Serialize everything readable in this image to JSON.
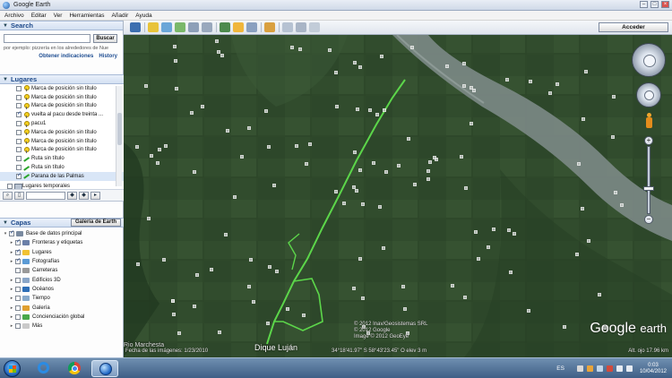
{
  "window": {
    "title": "Google Earth"
  },
  "menu": [
    "Archivo",
    "Editar",
    "Ver",
    "Herramientas",
    "Añadir",
    "Ayuda"
  ],
  "search": {
    "header": "Search",
    "button_label": "Buscar",
    "hint": "por ejemplo: pizzería en los alrededores de Nue",
    "link_directions": "Obtener indicaciones",
    "link_history": "History"
  },
  "places": {
    "header": "Lugares",
    "items": [
      {
        "label": "Marca de posición sin título",
        "icon": "pushpin-icon",
        "checked": false
      },
      {
        "label": "Marca de posición sin título",
        "icon": "pushpin-icon",
        "checked": false
      },
      {
        "label": "Marca de posición sin título",
        "icon": "pushpin-icon",
        "checked": false
      },
      {
        "label": "vuelta al pacu desde treinta ...",
        "icon": "pushpin-icon",
        "checked": true
      },
      {
        "label": "pacu1",
        "icon": "pushpin-icon",
        "checked": false
      },
      {
        "label": "Marca de posición sin título",
        "icon": "pushpin-icon",
        "checked": false
      },
      {
        "label": "Marca de posición sin título",
        "icon": "pushpin-icon",
        "checked": false
      },
      {
        "label": "Marca de posición sin título",
        "icon": "pushpin-icon",
        "checked": false
      },
      {
        "label": "Ruta sin título",
        "icon": "route-icon",
        "checked": false
      },
      {
        "label": "Ruta sin título",
        "icon": "route-icon",
        "checked": false
      },
      {
        "label": "Parana de las Palmas",
        "icon": "route-icon",
        "checked": true
      },
      {
        "label": "Lugares temporales",
        "icon": "folder-icon",
        "checked": false
      }
    ]
  },
  "layers": {
    "header": "Capas",
    "gallery_button": "Galería de Earth",
    "items": [
      {
        "label": "Base de datos principal",
        "color": "#7a8aa0"
      },
      {
        "label": "Fronteras y etiquetas",
        "color": "#6a7fa8"
      },
      {
        "label": "Lugares",
        "color": "#f1c232"
      },
      {
        "label": "Fotografías",
        "color": "#5b9bd5"
      },
      {
        "label": "Carreteras",
        "color": "#9a9a9a"
      },
      {
        "label": "Edificios 3D",
        "color": "#8aa6c8"
      },
      {
        "label": "Océanos",
        "color": "#2e6fb7"
      },
      {
        "label": "Tiempo",
        "color": "#88aacc"
      },
      {
        "label": "Galería",
        "color": "#e0a030"
      },
      {
        "label": "Concienciación global",
        "color": "#4aa84a"
      },
      {
        "label": "Más",
        "color": "#c9c9c9"
      }
    ]
  },
  "toolbar": {
    "signin_label": "Acceder"
  },
  "map": {
    "credits_line1": "© 2012 Inav/Geosistemas SRL",
    "credits_line2": "© 2012 Google",
    "credits_line3": "Image © 2012 GeoEye",
    "place_label": "Dique Luján",
    "place_label_left": "Rio Marchesta",
    "imagery_date": "Fecha de las imágenes: 1/23/2010",
    "coordinates": "34°18'41.97\" S  58°43'23.45\" O  elev    3 m",
    "eye_alt": "Alt. ojo  17.96 km",
    "logo_word1": "Google",
    "logo_word2": "earth"
  },
  "taskbar": {
    "lang": "ES",
    "time": "0:03",
    "date": "10/04/2012"
  }
}
